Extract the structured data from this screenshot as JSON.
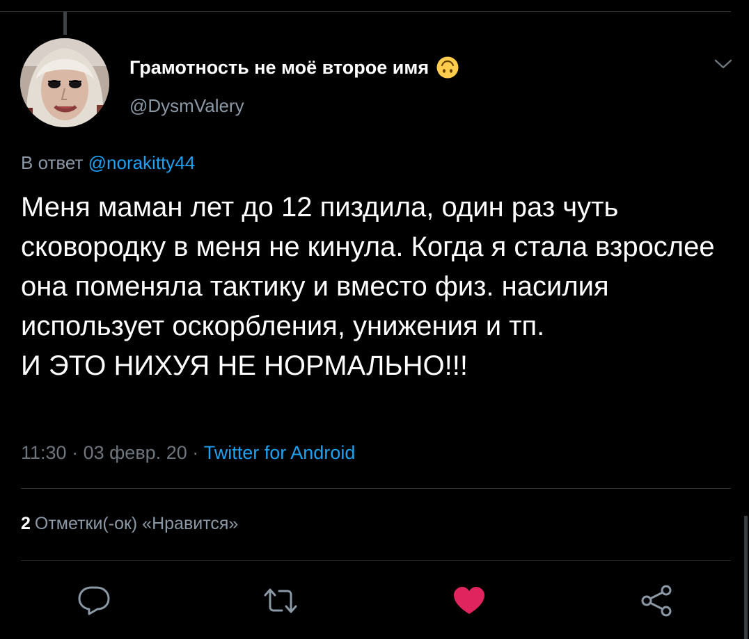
{
  "author": {
    "name": "Грамотность не моё второе имя",
    "handle": "@DysmValery",
    "name_emoji_icon": "upside-down-face-icon"
  },
  "reply": {
    "prefix": "В ответ",
    "mention": "@norakitty44"
  },
  "tweet": {
    "text": "Меня маман лет до 12 пиздила, один раз чуть сковородку в меня не кинула. Когда я стала взрослее она поменяла тактику и вместо физ. насилия использует оскорбления, унижения и тп.\nИ ЭТО НИХУЯ НЕ НОРМАЛЬНО!!!"
  },
  "meta": {
    "time": "11:30",
    "separator": " · ",
    "date": "03 февр. 20",
    "source": "Twitter for Android"
  },
  "stats": {
    "likes_count": "2",
    "likes_label": "Отметки(-ок) «Нравится»"
  },
  "actions": [
    {
      "name": "reply",
      "icon": "reply-bubble-icon"
    },
    {
      "name": "retweet",
      "icon": "retweet-icon"
    },
    {
      "name": "like",
      "icon": "heart-filled-icon",
      "active": true
    },
    {
      "name": "share",
      "icon": "share-icon"
    }
  ],
  "colors": {
    "background": "#000000",
    "text_primary": "#ffffff",
    "text_secondary": "#8b98a5",
    "accent": "#1da1f2",
    "like_active": "#e0245e",
    "divider": "#2f3336"
  }
}
